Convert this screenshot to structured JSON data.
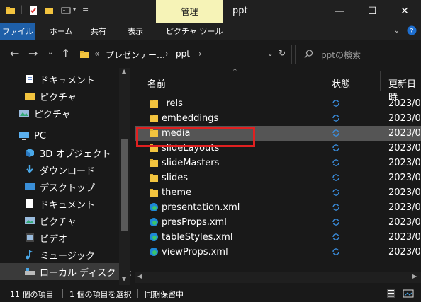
{
  "titlebar": {
    "context_tab": "管理",
    "window_title": "ppt",
    "minimize": "—",
    "maximize": "☐",
    "close": "✕"
  },
  "ribbon": {
    "tabs": [
      "ファイル",
      "ホーム",
      "共有",
      "表示",
      "ピクチャ ツール"
    ]
  },
  "address": {
    "overflow": "«",
    "crumbs": [
      "プレゼンテー…",
      "ppt"
    ],
    "search_placeholder": "pptの検索"
  },
  "nav": {
    "items": [
      {
        "label": "ドキュメント",
        "icon": "document-icon"
      },
      {
        "label": "ピクチャ",
        "icon": "folder-icon"
      },
      {
        "label": "ピクチャ",
        "icon": "pictures-icon"
      },
      {
        "label": "PC",
        "icon": "pc-icon"
      },
      {
        "label": "3D オブジェクト",
        "icon": "cube-icon"
      },
      {
        "label": "ダウンロード",
        "icon": "download-icon"
      },
      {
        "label": "デスクトップ",
        "icon": "desktop-icon"
      },
      {
        "label": "ドキュメント",
        "icon": "document-icon"
      },
      {
        "label": "ピクチャ",
        "icon": "pictures-icon"
      },
      {
        "label": "ビデオ",
        "icon": "video-icon"
      },
      {
        "label": "ミュージック",
        "icon": "music-icon"
      },
      {
        "label": "ローカル ディスク (C:)",
        "icon": "drive-icon"
      }
    ]
  },
  "columns": {
    "name": "名前",
    "status": "状態",
    "date": "更新日時"
  },
  "files": [
    {
      "name": "_rels",
      "type": "folder",
      "date": "2023/0"
    },
    {
      "name": "embeddings",
      "type": "folder",
      "date": "2023/0"
    },
    {
      "name": "media",
      "type": "folder",
      "date": "2023/0"
    },
    {
      "name": "slideLayouts",
      "type": "folder",
      "date": "2023/0"
    },
    {
      "name": "slideMasters",
      "type": "folder",
      "date": "2023/0"
    },
    {
      "name": "slides",
      "type": "folder",
      "date": "2023/0"
    },
    {
      "name": "theme",
      "type": "folder",
      "date": "2023/0"
    },
    {
      "name": "presentation.xml",
      "type": "edge",
      "date": "2023/0"
    },
    {
      "name": "presProps.xml",
      "type": "edge",
      "date": "2023/0"
    },
    {
      "name": "tableStyles.xml",
      "type": "edge",
      "date": "2023/0"
    },
    {
      "name": "viewProps.xml",
      "type": "edge",
      "date": "2023/0"
    }
  ],
  "status": {
    "count": "11 個の項目",
    "selected": "1 個の項目を選択",
    "sync": "同期保留中"
  },
  "colors": {
    "accent": "#1e5fa8",
    "manage_tab": "#f6f3b7",
    "highlight_box": "#e02020",
    "folder": "#f3c43f"
  }
}
